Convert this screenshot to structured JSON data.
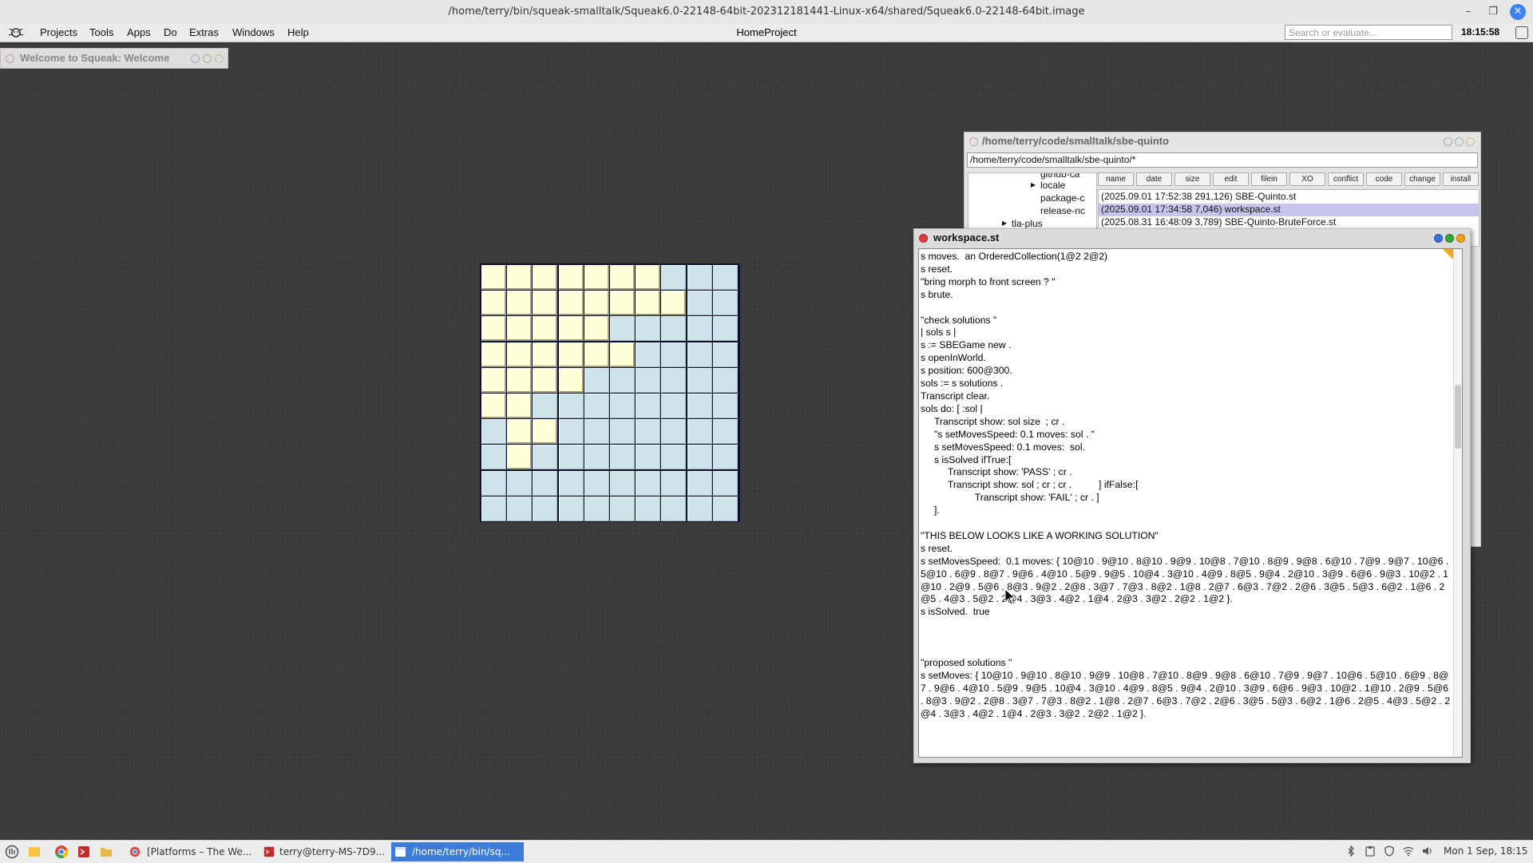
{
  "window": {
    "title": "/home/terry/bin/squeak-smalltalk/Squeak6.0-22148-64bit-202312181441-Linux-x64/shared/Squeak6.0-22148-64bit.image",
    "controls": {
      "minimize": "–",
      "maximize": "❐",
      "close": "✕"
    }
  },
  "menubar": {
    "items": [
      "Projects",
      "Tools",
      "Apps",
      "Do",
      "Extras",
      "Windows",
      "Help"
    ],
    "project": "HomeProject",
    "search_placeholder": "Search or evaluate...",
    "clock": "18:15:58"
  },
  "welcome_window": {
    "title": "Welcome to Squeak: Welcome"
  },
  "board": {
    "rows": 10,
    "cols": 10,
    "lit_per_row": [
      7,
      8,
      5,
      6,
      4,
      2,
      2,
      1,
      0,
      0
    ],
    "lit_row_offset": [
      0,
      0,
      0,
      0,
      0,
      0,
      1,
      1,
      0,
      0
    ],
    "colors": {
      "lit": "#ffffd8",
      "unlit": "#cfe3ea"
    }
  },
  "filelist": {
    "title": "/home/terry/code/smalltalk/sbe-quinto",
    "path": "/home/terry/code/smalltalk/sbe-quinto/*",
    "tree": [
      "github-ca",
      "locale",
      "package-c",
      "release-nc",
      "tla-plus"
    ],
    "buttons": [
      "name",
      "date",
      "size",
      "edit",
      "filein",
      "XO",
      "conflict",
      "code",
      "change",
      "install"
    ],
    "files": [
      "(2025.09.01 17:52:38 291,126) SBE-Quinto.st",
      "(2025.09.01 17:34:58 7,046) workspace.st",
      "(2025.08.31 16:48:09 3,789) SBE-Quinto-BruteForce.st"
    ],
    "selected_index": 1
  },
  "workspace": {
    "title": "workspace.st",
    "text": "s moves.  an OrderedCollection(1@2 2@2)\ns reset.\n\"bring morph to front screen ? \"\ns brute.\n\n\"check solutions \"\n| sols s |\ns := SBEGame new .\ns openInWorld.\ns position: 600@300.\nsols := s solutions .\nTranscript clear.\nsols do: [ :sol |\n     Transcript show: sol size  ; cr .\n     \"s setMovesSpeed: 0.1 moves: sol . \"\n     s setMovesSpeed: 0.1 moves:  sol.\n     s isSolved ifTrue:[\n          Transcript show: 'PASS' ; cr .\n          Transcript show: sol ; cr ; cr .          ] ifFalse:[\n                    Transcript show: 'FAIL' ; cr . ]\n     ].\n\n\"THIS BELOW LOOKS LIKE A WORKING SOLUTION\"\ns reset.\ns setMovesSpeed:  0.1 moves: { 10@10 . 9@10 . 8@10 . 9@9 . 10@8 . 7@10 . 8@9 . 9@8 . 6@10 . 7@9 . 9@7 . 10@6 . 5@10 . 6@9 . 8@7 . 9@6 . 4@10 . 5@9 . 9@5 . 10@4 . 3@10 . 4@9 . 8@5 . 9@4 . 2@10 . 3@9 . 6@6 . 9@3 . 10@2 . 1@10 . 2@9 . 5@6 . 8@3 . 9@2 . 2@8 . 3@7 . 7@3 . 8@2 . 1@8 . 2@7 . 6@3 . 7@2 . 2@6 . 3@5 . 5@3 . 6@2 . 1@6 . 2@5 . 4@3 . 5@2 . 2@4 . 3@3 . 4@2 . 1@4 . 2@3 . 3@2 . 2@2 . 1@2 }.\ns isSolved.  true\n\n\n\n\"proposed solutions \"\ns setMoves: { 10@10 . 9@10 . 8@10 . 9@9 . 10@8 . 7@10 . 8@9 . 9@8 . 6@10 . 7@9 . 9@7 . 10@6 . 5@10 . 6@9 . 8@7 . 9@6 . 4@10 . 5@9 . 9@5 . 10@4 . 3@10 . 4@9 . 8@5 . 9@4 . 2@10 . 3@9 . 6@6 . 9@3 . 10@2 . 1@10 . 2@9 . 5@6 . 8@3 . 9@2 . 2@8 . 3@7 . 7@3 . 8@2 . 1@8 . 2@7 . 6@3 . 7@2 . 2@6 . 3@5 . 5@3 . 6@2 . 1@6 . 2@5 . 4@3 . 5@2 . 2@4 . 3@3 . 4@2 . 1@4 . 2@3 . 3@2 . 2@2 . 1@2 }."
  },
  "taskbar": {
    "tasks": [
      {
        "label": "[Platforms – The We...",
        "icon": "chrome-icon"
      },
      {
        "label": "terry@terry-MS-7D9...",
        "icon": "terminal-icon"
      },
      {
        "label": "/home/terry/bin/sq...",
        "icon": "window-icon",
        "active": true
      }
    ],
    "clock": "Mon  1 Sep, 18:15",
    "colors": {
      "active_task": "#3d7bdc"
    }
  }
}
